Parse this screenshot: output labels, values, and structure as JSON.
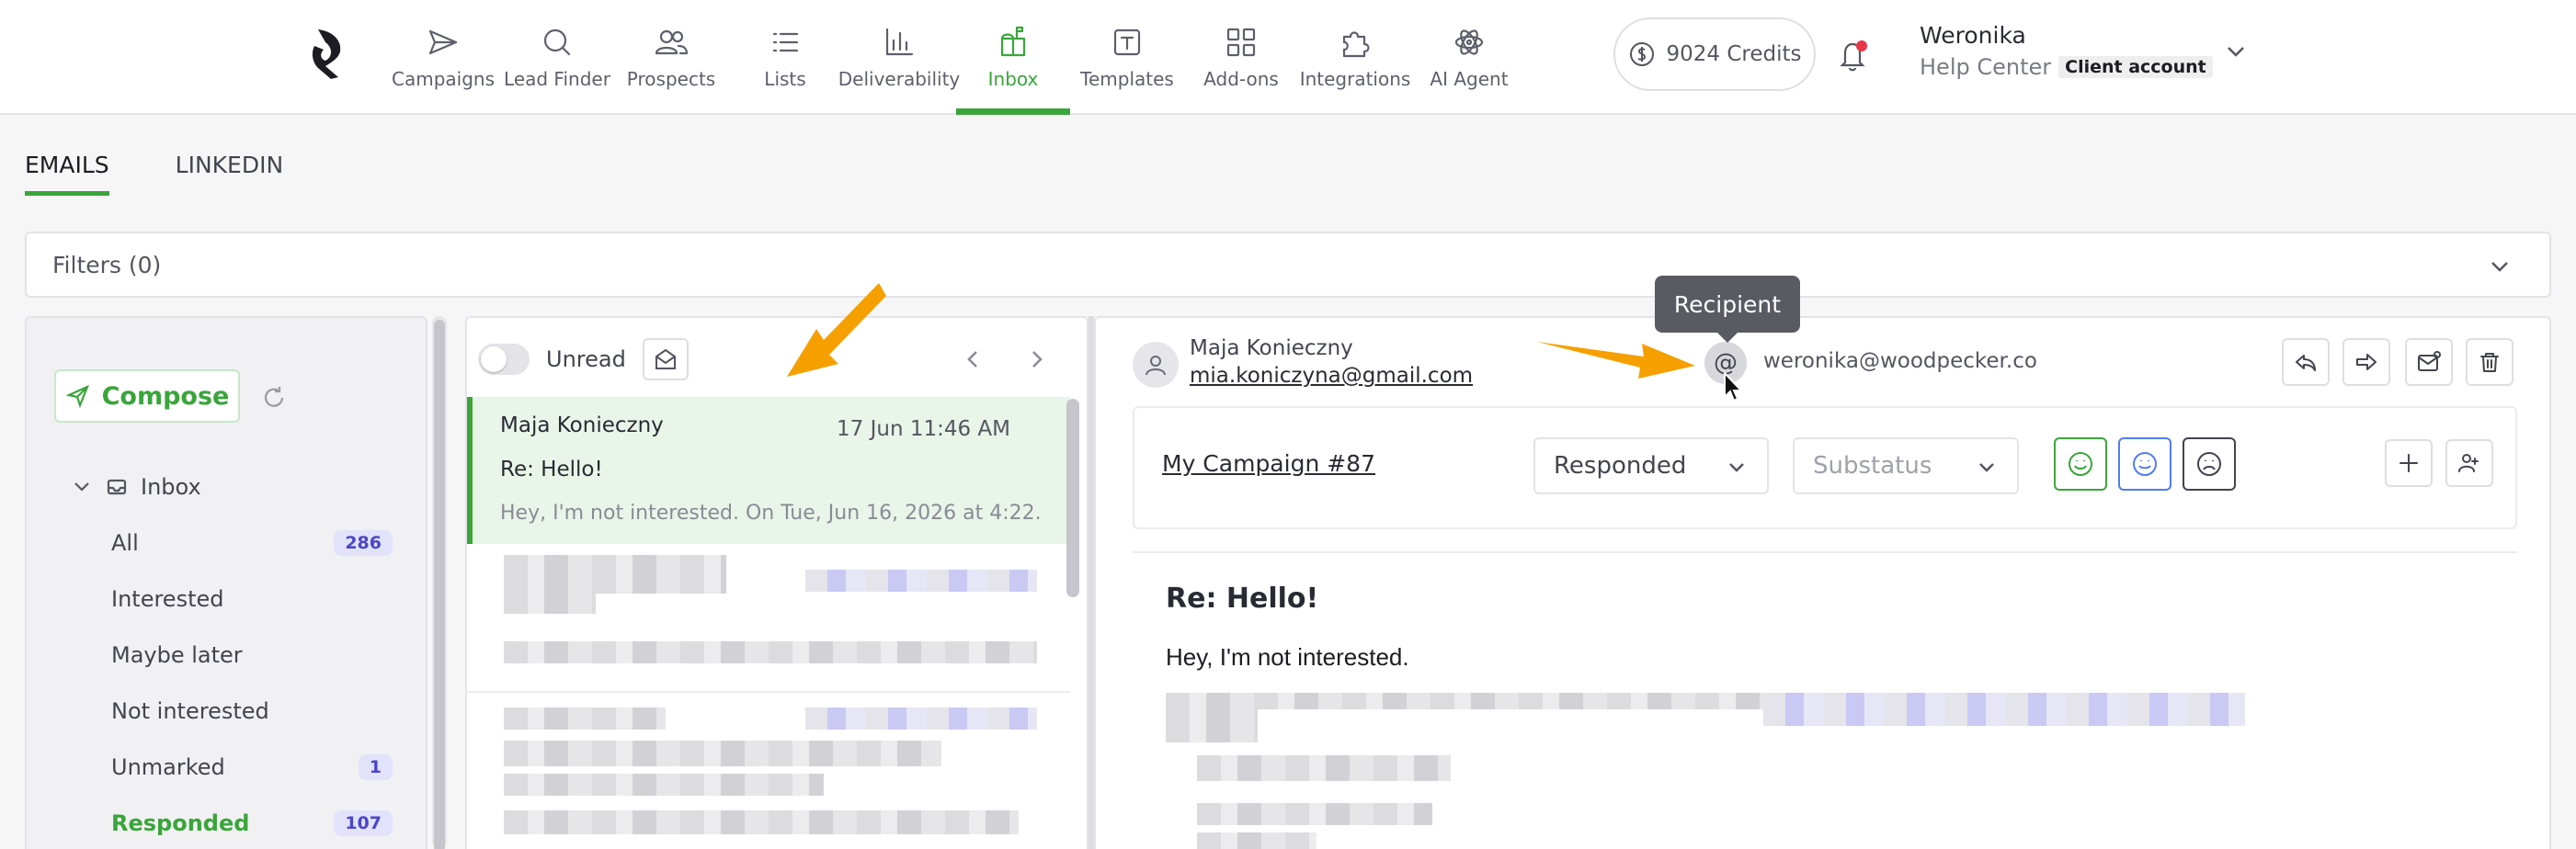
{
  "nav": {
    "items": [
      {
        "label": "Campaigns"
      },
      {
        "label": "Lead Finder"
      },
      {
        "label": "Prospects"
      },
      {
        "label": "Lists"
      },
      {
        "label": "Deliverability"
      },
      {
        "label": "Inbox"
      },
      {
        "label": "Templates"
      },
      {
        "label": "Add-ons"
      },
      {
        "label": "Integrations"
      },
      {
        "label": "AI Agent"
      }
    ],
    "active": "Inbox"
  },
  "credits": "9024 Credits",
  "user": {
    "name": "Weronika",
    "org": "Help Center",
    "badge": "Client account"
  },
  "channel_tabs": [
    {
      "label": "EMAILS"
    },
    {
      "label": "LINKEDIN"
    }
  ],
  "filters": {
    "label": "Filters (0)"
  },
  "sidebar": {
    "compose_label": "Compose",
    "inbox_label": "Inbox",
    "folders": [
      {
        "label": "All",
        "count": "286"
      },
      {
        "label": "Interested",
        "count": ""
      },
      {
        "label": "Maybe later",
        "count": ""
      },
      {
        "label": "Not interested",
        "count": ""
      },
      {
        "label": "Unmarked",
        "count": "1"
      },
      {
        "label": "Responded",
        "count": "107"
      }
    ]
  },
  "list": {
    "unread_label": "Unread",
    "selected": {
      "from": "Maja Konieczny",
      "date": "17 Jun 11:46 AM",
      "subject": "Re: Hello!",
      "preview": "Hey, I'm not interested. On Tue, Jun 16, 2026 at 4:22..."
    }
  },
  "detail": {
    "sender_name": "Maja Konieczny",
    "sender_email": "mia.koniczyna@gmail.com",
    "recipient_email": "weronika@woodpecker.co",
    "tooltip": "Recipient",
    "campaign": "My Campaign #87",
    "status": "Responded",
    "substatus_placeholder": "Substatus",
    "subject": "Re: Hello!",
    "body_line": "Hey, I'm not interested."
  },
  "colors": {
    "accent": "#3aa53a",
    "badge_bg": "#e3e2fb",
    "badge_text": "#4b46c8",
    "annotation": "#f5a000"
  }
}
